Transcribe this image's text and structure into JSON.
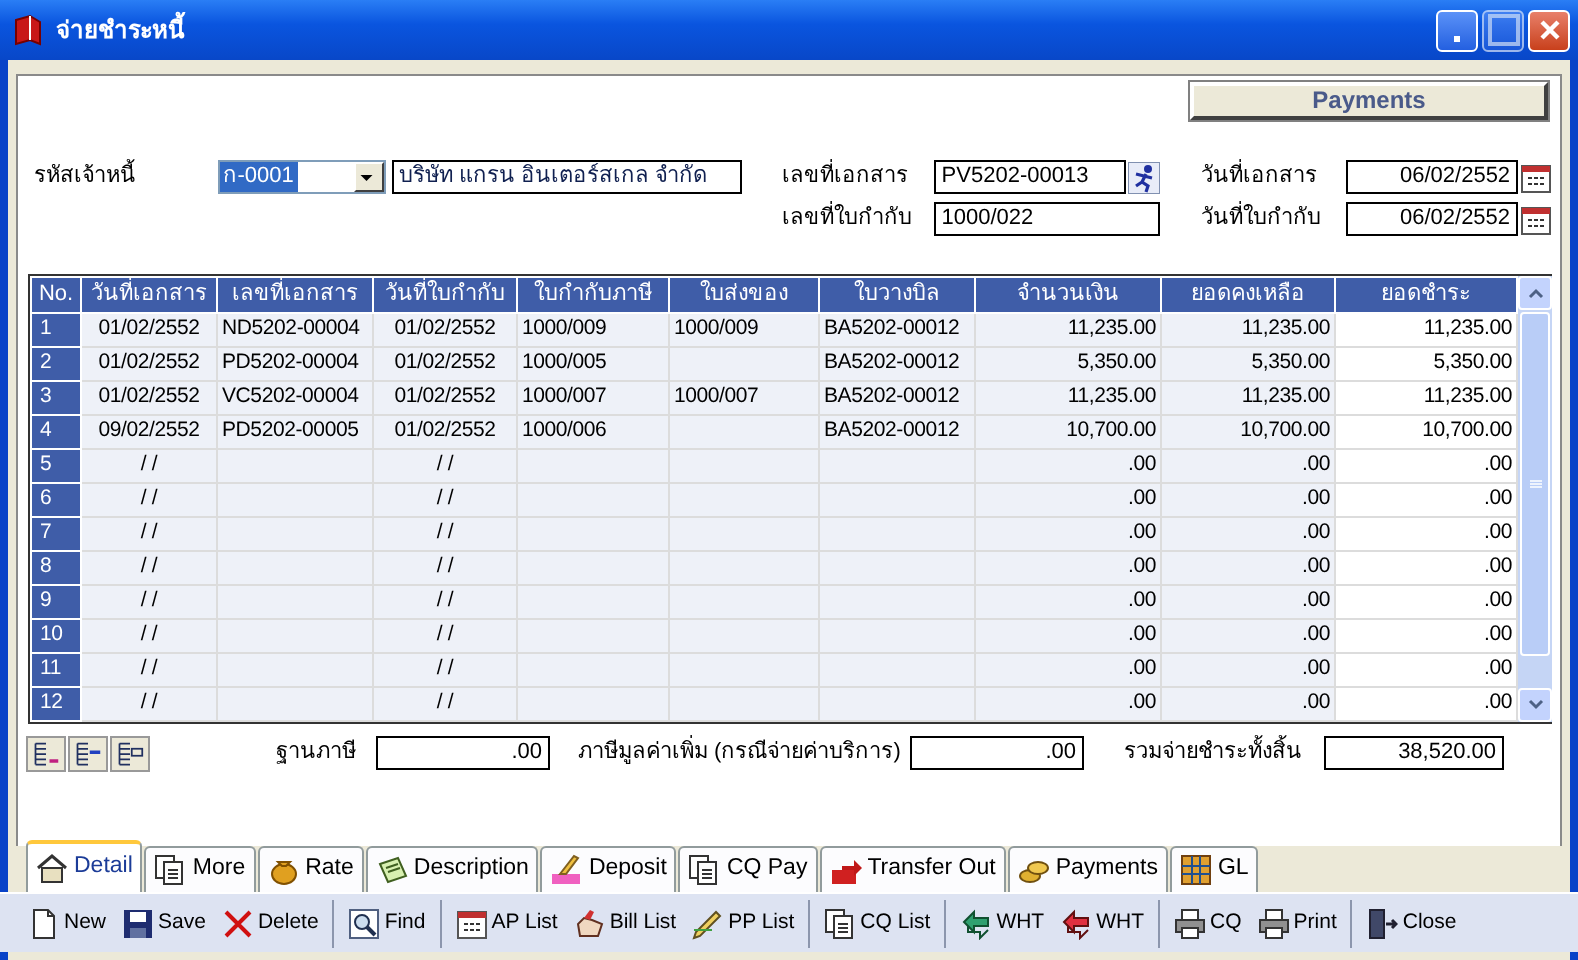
{
  "window": {
    "title": "จ่ายชำระหนี้"
  },
  "header_label": "Payments",
  "form": {
    "creditor_code": {
      "label": "รหัสเจ้าหนี้",
      "value": "ก-0001",
      "text_selected": true
    },
    "creditor_name": {
      "value": "บริษัท แกรน อินเตอร์สเกล จำกัด"
    },
    "doc_no": {
      "label": "เลขที่เอกสาร",
      "value": "PV5202-00013"
    },
    "tax_invoice_no": {
      "label": "เลขที่ใบกำกับ",
      "value": "1000/022"
    },
    "doc_date": {
      "label": "วันที่เอกสาร",
      "value": "06/02/2552"
    },
    "invoice_date": {
      "label": "วันที่ใบกำกับ",
      "value": "06/02/2552"
    }
  },
  "table": {
    "columns": [
      {
        "label": "No.",
        "kind": "index"
      },
      {
        "label": "วันที่เอกสาร",
        "kind": "date"
      },
      {
        "label": "เลขที่เอกสาร",
        "kind": "text"
      },
      {
        "label": "วันที่ใบกำกับ",
        "kind": "date"
      },
      {
        "label": "ใบกำกับภาษี",
        "kind": "text"
      },
      {
        "label": "ใบส่งของ",
        "kind": "text"
      },
      {
        "label": "ใบวางบิล",
        "kind": "text"
      },
      {
        "label": "จำนวนเงิน",
        "kind": "amount"
      },
      {
        "label": "ยอดคงเหลือ",
        "kind": "amount"
      },
      {
        "label": "ยอดชำระ",
        "kind": "payment"
      }
    ],
    "rows": [
      [
        "1",
        "01/02/2552",
        "ND5202-00004",
        "01/02/2552",
        "1000/009",
        "1000/009",
        "BA5202-00012",
        "11,235.00",
        "11,235.00",
        "11,235.00"
      ],
      [
        "2",
        "01/02/2552",
        "PD5202-00004",
        "01/02/2552",
        "1000/005",
        null,
        "BA5202-00012",
        "5,350.00",
        "5,350.00",
        "5,350.00"
      ],
      [
        "3",
        "01/02/2552",
        "VC5202-00004",
        "01/02/2552",
        "1000/007",
        "1000/007",
        "BA5202-00012",
        "11,235.00",
        "11,235.00",
        "11,235.00"
      ],
      [
        "4",
        "09/02/2552",
        "PD5202-00005",
        "01/02/2552",
        "1000/006",
        null,
        "BA5202-00012",
        "10,700.00",
        "10,700.00",
        "10,700.00"
      ],
      [
        "5",
        "/ /",
        null,
        "/ /",
        null,
        null,
        null,
        ".00",
        ".00",
        ".00"
      ],
      [
        "6",
        "/ /",
        null,
        "/ /",
        null,
        null,
        null,
        ".00",
        ".00",
        ".00"
      ],
      [
        "7",
        "/ /",
        null,
        "/ /",
        null,
        null,
        null,
        ".00",
        ".00",
        ".00"
      ],
      [
        "8",
        "/ /",
        null,
        "/ /",
        null,
        null,
        null,
        ".00",
        ".00",
        ".00"
      ],
      [
        "9",
        "/ /",
        null,
        "/ /",
        null,
        null,
        null,
        ".00",
        ".00",
        ".00"
      ],
      [
        "10",
        "/ /",
        null,
        "/ /",
        null,
        null,
        null,
        ".00",
        ".00",
        ".00"
      ],
      [
        "11",
        "/ /",
        null,
        "/ /",
        null,
        null,
        null,
        ".00",
        ".00",
        ".00"
      ],
      [
        "12",
        "/ /",
        null,
        "/ /",
        null,
        null,
        null,
        ".00",
        ".00",
        ".00"
      ]
    ]
  },
  "totals": {
    "tax_base": {
      "label": "ฐานภาษี",
      "value": ".00"
    },
    "vat": {
      "label": "ภาษีมูลค่าเพิ่ม (กรณีจ่ายค่าบริการ)",
      "value": ".00"
    },
    "grand_total": {
      "label": "รวมจ่ายชำระทั้งสิ้น",
      "value": "38,520.00"
    }
  },
  "tabs": [
    {
      "label": "Detail",
      "selected": true
    },
    {
      "label": "More",
      "selected": false
    },
    {
      "label": "Rate",
      "selected": false
    },
    {
      "label": "Description",
      "selected": false
    },
    {
      "label": "Deposit",
      "selected": false
    },
    {
      "label": "CQ Pay",
      "selected": false
    },
    {
      "label": "Transfer Out",
      "selected": false
    },
    {
      "label": "Payments",
      "selected": false
    },
    {
      "label": "GL",
      "selected": false
    }
  ],
  "toolbar": [
    [
      "New",
      "Save",
      "Delete"
    ],
    [
      "Find"
    ],
    [
      "AP List",
      "Bill List",
      "PP List"
    ],
    [
      "CQ List"
    ],
    [
      "WHT",
      "WHT"
    ],
    [
      "CQ",
      "Print"
    ],
    [
      "Close"
    ]
  ]
}
